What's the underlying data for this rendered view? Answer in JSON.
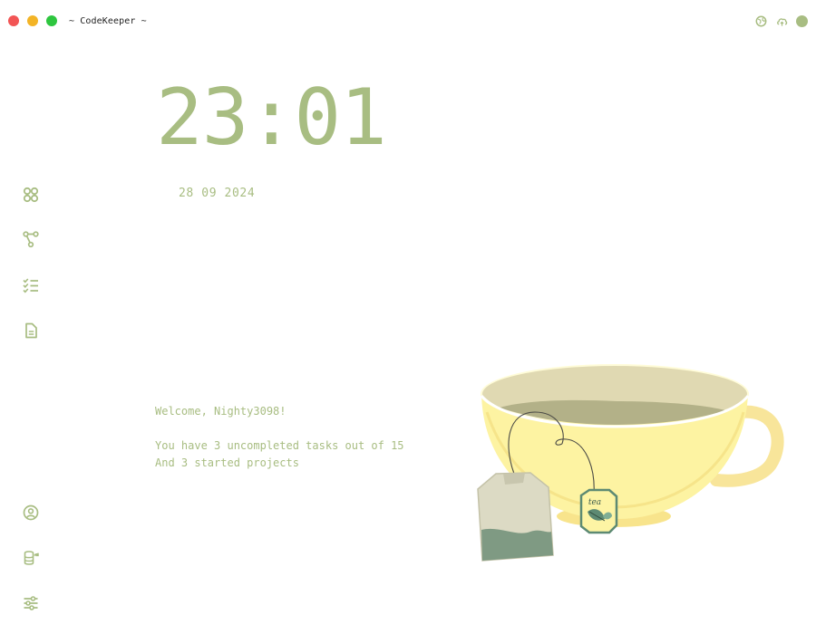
{
  "window": {
    "title": "~ CodeKeeper ~",
    "controls": [
      "close",
      "minimize",
      "maximize"
    ]
  },
  "toolbar": {
    "icons": [
      "globe-icon",
      "cloud-upload-icon",
      "status-dot"
    ]
  },
  "sidebar": {
    "top_items": [
      {
        "name": "dashboard",
        "icon": "apps-grid-icon"
      },
      {
        "name": "git-branches",
        "icon": "git-branch-icon"
      },
      {
        "name": "tasks",
        "icon": "checklist-icon"
      },
      {
        "name": "notes",
        "icon": "document-icon"
      }
    ],
    "bottom_items": [
      {
        "name": "profile",
        "icon": "user-circle-icon"
      },
      {
        "name": "sync",
        "icon": "database-sync-icon"
      },
      {
        "name": "settings",
        "icon": "sliders-icon"
      }
    ]
  },
  "clock": {
    "time": "23:01",
    "date": "28 09 2024"
  },
  "summary": {
    "welcome": "Welcome, Nighty3098!",
    "tasks_line": "You have 3 uncompleted tasks out of 15",
    "projects_line": "And 3 started projects"
  },
  "illustration": {
    "name": "tea-cup-illustration",
    "tag_text": "tea"
  },
  "colors": {
    "accent": "#a8bd82",
    "close": "#f25555",
    "minimize": "#f3b426",
    "maximize": "#2ec63f",
    "cup": "#fdf3a2",
    "tea_liquid": "#b3b188"
  }
}
